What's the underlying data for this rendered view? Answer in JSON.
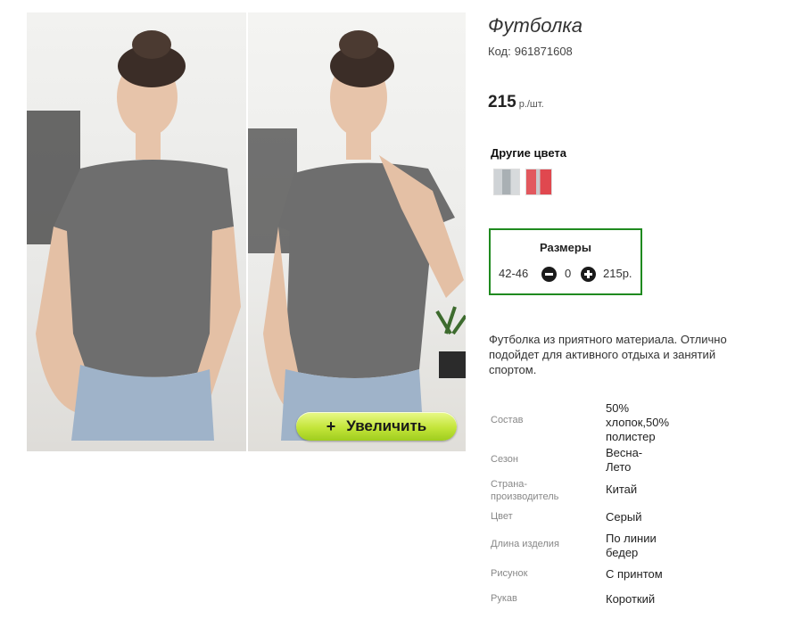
{
  "product": {
    "title": "Футболка",
    "code_label": "Код:",
    "code_value": "961871608",
    "price_value": "215",
    "price_unit": "р./шт.",
    "other_colors_label": "Другие цвета",
    "swatch_colors": [
      "#b9c0c4",
      "#e0484f"
    ]
  },
  "gallery": {
    "zoom_label": "Увеличить",
    "zoom_icon": "plus-icon",
    "tshirt_color": "#6e6e6e"
  },
  "sizes": {
    "header": "Размеры",
    "row": {
      "label": "42-46",
      "quantity": "0",
      "total": "215р."
    }
  },
  "description": "Футболка из приятного материала. Отлично подойдет для активного отдыха и занятий спортом.",
  "properties": [
    {
      "key": "Состав",
      "value": "50% хлопок,50% полистер"
    },
    {
      "key": "Сезон",
      "value": "Весна-Лето"
    },
    {
      "key": "Страна-производитель",
      "value": "Китай"
    },
    {
      "key": "Цвет",
      "value": "Серый"
    },
    {
      "key": "Длина изделия",
      "value": "По линии бедер"
    },
    {
      "key": "Рисунок",
      "value": "С принтом"
    },
    {
      "key": "Рукав",
      "value": "Короткий"
    }
  ]
}
